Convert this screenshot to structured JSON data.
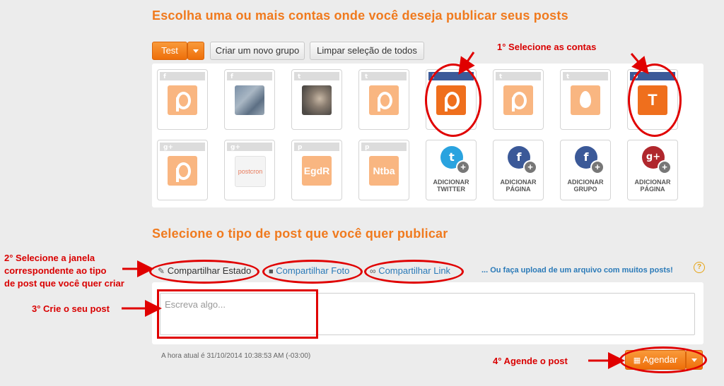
{
  "section1": {
    "title": "Escolha uma ou mais contas onde você deseja publicar seus posts"
  },
  "toolbar": {
    "group_label": "Test",
    "create_group_label": "Criar um novo grupo",
    "clear_selection_label": "Limpar seleção de todos"
  },
  "accounts_row1": [
    {
      "network": "f",
      "pic_text": ""
    },
    {
      "network": "f",
      "pic_text": ""
    },
    {
      "network": "t",
      "pic_text": ""
    },
    {
      "network": "t",
      "pic_text": ""
    },
    {
      "network": "f",
      "pic_text": ""
    },
    {
      "network": "t",
      "pic_text": ""
    },
    {
      "network": "t",
      "pic_text": ""
    },
    {
      "network": "p",
      "pic_text": "T"
    }
  ],
  "accounts_row2": [
    {
      "network": "g+",
      "pic_text": ""
    },
    {
      "network": "g+",
      "pic_text": "postcron"
    },
    {
      "network": "p",
      "pic_text": "EgdR"
    },
    {
      "network": "p",
      "pic_text": "Ntba"
    }
  ],
  "add_tiles": [
    {
      "icon_letter": "t",
      "line1": "ADICIONAR",
      "line2": "TWITTER",
      "color": "#2aa3df"
    },
    {
      "icon_letter": "f",
      "line1": "ADICIONAR",
      "line2": "PÁGINA",
      "color": "#3b5998"
    },
    {
      "icon_letter": "f",
      "line1": "ADICIONAR",
      "line2": "GRUPO",
      "color": "#3b5998"
    },
    {
      "icon_letter": "g+",
      "line1": "ADICIONAR",
      "line2": "PÁGINA",
      "color": "#b0272d"
    }
  ],
  "section2": {
    "title": "Selecione o tipo de post que você quer publicar"
  },
  "tabs": {
    "status": "Compartilhar Estado",
    "photo": "Compartilhar Foto",
    "link": "Compartilhar Link",
    "upload": "... Ou faça upload de um arquivo com muitos posts!",
    "help": "?"
  },
  "post": {
    "placeholder": "Escreva algo..."
  },
  "time_note": "A hora atual é 31/10/2014 10:38:53 AM (-03:00)",
  "schedule": {
    "label": "Agendar"
  },
  "annotations": {
    "step1": "1° Selecione as contas",
    "step2_line1": "2° Selecione a janela",
    "step2_line2": "correspondente ao tipo",
    "step2_line3": "de post que você quer criar",
    "step3": "3° Crie o seu post",
    "step4": "4° Agende o post"
  },
  "colors": {
    "accent": "#f07a1e",
    "annotation": "#e00000",
    "link": "#2a7ab8"
  }
}
